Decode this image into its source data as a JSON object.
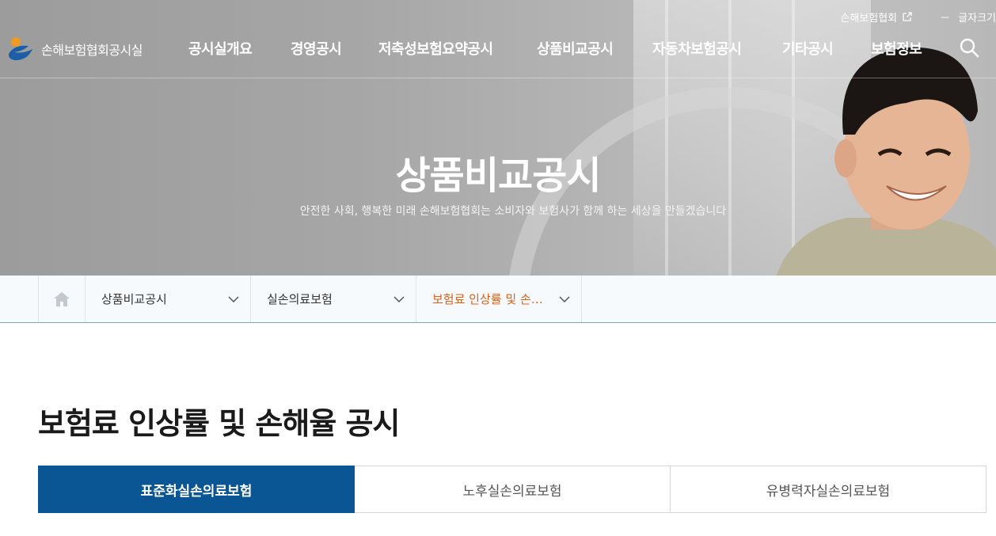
{
  "header": {
    "logo_text": "손해보험협회공시실",
    "util_link": "손해보험협회",
    "font_size_minus": "－",
    "font_size_label": "글자크기",
    "nav": [
      "공시실개요",
      "경영공시",
      "저축성보험요약공시",
      "상품비교공시",
      "자동차보험공시",
      "기타공시",
      "보험정보"
    ]
  },
  "hero": {
    "title": "상품비교공시",
    "subtitle": "안전한 사회, 행복한 미래 손해보험협회는 소비자와 보험사가 함께 하는 세상을 만들겠습니다"
  },
  "breadcrumb": {
    "items": [
      "상품비교공시",
      "실손의료보험",
      "보험료 인상률 및 손해율 공시"
    ]
  },
  "page": {
    "title": "보험료 인상률 및 손해율 공시",
    "tabs": [
      "표준화실손의료보험",
      "노후실손의료보험",
      "유병력자실손의료보험"
    ]
  },
  "colors": {
    "accent_blue": "#0a5593",
    "accent_orange": "#e0601a"
  }
}
